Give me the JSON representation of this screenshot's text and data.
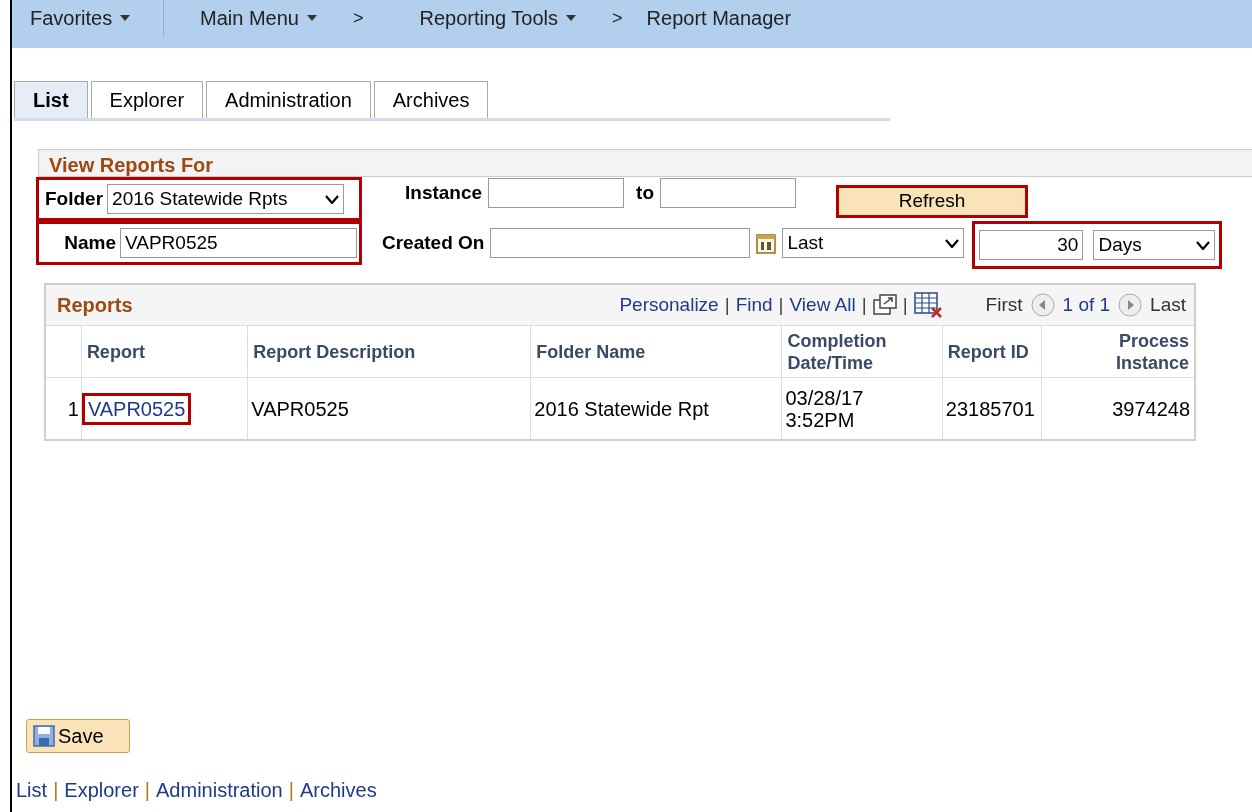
{
  "nav": [
    {
      "kind": "menu",
      "label": "Favorites"
    },
    {
      "kind": "menu",
      "label": "Main Menu"
    },
    {
      "kind": "separator",
      "label": ">"
    },
    {
      "kind": "menu",
      "label": "Reporting Tools"
    },
    {
      "kind": "separator",
      "label": ">"
    },
    {
      "kind": "page",
      "label": "Report Manager"
    }
  ],
  "tabs": [
    {
      "label": "List",
      "selected": true
    },
    {
      "label": "Explorer",
      "selected": false
    },
    {
      "label": "Administration",
      "selected": false
    },
    {
      "label": "Archives",
      "selected": false
    }
  ],
  "filters": {
    "title": "View Reports For",
    "folder": {
      "label": "Folder",
      "value": "2016 Statewide Rpts",
      "highlighted": true
    },
    "instance": {
      "label": "Instance"
    },
    "to": {
      "label": "to"
    },
    "refresh": {
      "label": "Refresh",
      "highlighted": true
    },
    "name": {
      "label": "Name",
      "value": "VAPR0525",
      "highlighted": true
    },
    "created_on": {
      "label": "Created On"
    },
    "range": {
      "value": "Last"
    },
    "period": {
      "amount": "30",
      "unit": "Days",
      "highlighted": true
    }
  },
  "grid": {
    "title": "Reports",
    "links": [
      "Personalize",
      "Find",
      "View All"
    ],
    "divider": "|",
    "pager": {
      "first": "First",
      "count": "1 of 1",
      "last": "Last"
    },
    "columns": [
      "Report",
      "Report Description",
      "Folder Name",
      "Completion Date/Time",
      "Report ID",
      "Process Instance"
    ],
    "rows": [
      {
        "number": "1",
        "report": "VAPR0525",
        "highlighted": true,
        "description": "VAPR0525",
        "folder": "2016 Statewide Rpt",
        "date": "03/28/17",
        "time": "3:52PM",
        "report_id": "23185701",
        "process_instance": "3974248"
      }
    ]
  },
  "save": {
    "label": "Save"
  },
  "footer_links": [
    "List",
    "Explorer",
    "Administration",
    "Archives"
  ],
  "footer_divider": "|"
}
